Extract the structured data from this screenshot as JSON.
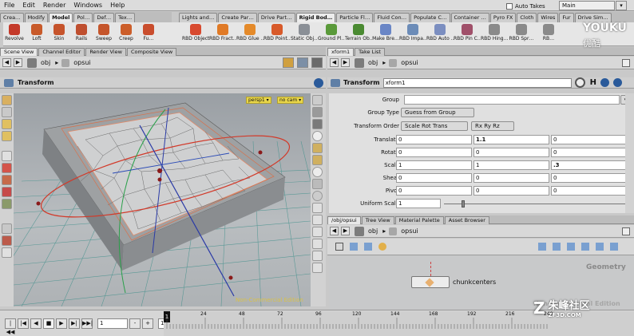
{
  "menubar": {
    "items": [
      "File",
      "Edit",
      "Render",
      "Windows",
      "Help"
    ],
    "auto_takes": "Auto Takes",
    "desktop": "Main"
  },
  "shelf_tabs_left": [
    "Crea…",
    "Modify",
    "Model",
    "Pol…",
    "Def…",
    "Tex…"
  ],
  "shelf_tabs_right": [
    "Lights and…",
    "Create Par…",
    "Drive Part…",
    "Rigid Bod…",
    "Particle Fl…",
    "Fluid Con…",
    "Populate C…",
    "Container …",
    "Pyro FX",
    "Cloth",
    "Wires",
    "Fur",
    "Drive Sim…"
  ],
  "tools_left": [
    {
      "label": "Revolve",
      "color": "#c43a2a"
    },
    {
      "label": "Loft",
      "color": "#c85a2a"
    },
    {
      "label": "Skin",
      "color": "#c6542c"
    },
    {
      "label": "Rails",
      "color": "#bf4f2f"
    },
    {
      "label": "Sweep",
      "color": "#c5552b"
    },
    {
      "label": "Creep",
      "color": "#cc5e2a"
    },
    {
      "label": "Fu…",
      "color": "#c94d2d"
    }
  ],
  "tools_right": [
    {
      "label": "RBD Object",
      "color": "#d84a2f"
    },
    {
      "label": "RBD Fract…",
      "color": "#e07a26"
    },
    {
      "label": "RBD Glue …",
      "color": "#e48a2a"
    },
    {
      "label": "RBD Point…",
      "color": "#d85a2a"
    },
    {
      "label": "Static Obj…",
      "color": "#8a8f96"
    },
    {
      "label": "Ground Pl…",
      "color": "#5a9a3a"
    },
    {
      "label": "Terrain Ob…",
      "color": "#4a8a32"
    },
    {
      "label": "Make Bre…",
      "color": "#6a86c6"
    },
    {
      "label": "RBD Impa…",
      "color": "#6c8cb8"
    },
    {
      "label": "RBD Auto …",
      "color": "#7b8ec0"
    },
    {
      "label": "RBD Pin C…",
      "color": "#a0506a"
    },
    {
      "label": "RBD Hing…",
      "color": "#8a8a8a"
    },
    {
      "label": "RBD Spr…",
      "color": "#8a8a8a"
    },
    {
      "label": "RB…",
      "color": "#8a8a8a"
    }
  ],
  "left_pane": {
    "tabs": [
      "Scene View",
      "Channel Editor",
      "Render View",
      "Composite View"
    ],
    "path": "obj",
    "node": "opsui",
    "header": "Transform",
    "camera": "persp1 ▾",
    "cam2": "no cam ▾",
    "watermark": "Non-Commercial Edition"
  },
  "right_pane": {
    "tabs": [
      "xform1",
      "Take List"
    ],
    "path": "obj",
    "node": "opsui",
    "header_type": "Transform",
    "header_name": "xform1",
    "h_label": "H"
  },
  "params": {
    "group_label": "Group",
    "group_value": "",
    "group_type_label": "Group Type",
    "group_type_value": "Guess from Group",
    "transform_order_label": "Transform Order",
    "transform_order_value": "Scale Rot Trans",
    "rot_order_value": "Rx Ry Rz",
    "translate_label": "Translate",
    "translate": [
      "0",
      "1.1",
      "0"
    ],
    "rotate_label": "Rotate",
    "rotate": [
      "0",
      "0",
      "0"
    ],
    "scale_label": "Scale",
    "scale": [
      "1",
      "1",
      ".3"
    ],
    "shear_label": "Shear",
    "shear": [
      "0",
      "0",
      "0"
    ],
    "pivot_label": "Pivot",
    "pivot": [
      "0",
      "0",
      "0"
    ],
    "uniform_scale_label": "Uniform Scale",
    "uniform_scale": "1"
  },
  "net_pane": {
    "tabs": [
      "/obj/opsui",
      "Tree View",
      "Material Palette",
      "Asset Browser"
    ],
    "path": "obj",
    "node": "opsui",
    "context": "Geometry",
    "node_name": "chunkcenters",
    "watermark": "Non-Commercial Edition"
  },
  "timeline": {
    "frame": "1",
    "start": "1",
    "current_marker": "1",
    "ticks": [
      "24",
      "48",
      "72",
      "96",
      "120",
      "144",
      "168",
      "192",
      "216",
      "240"
    ]
  },
  "overlay": {
    "youku": "YOUKU",
    "youku_cn": "优酷",
    "site": "朱峰社区",
    "site_url": "ZF3D.COM"
  }
}
